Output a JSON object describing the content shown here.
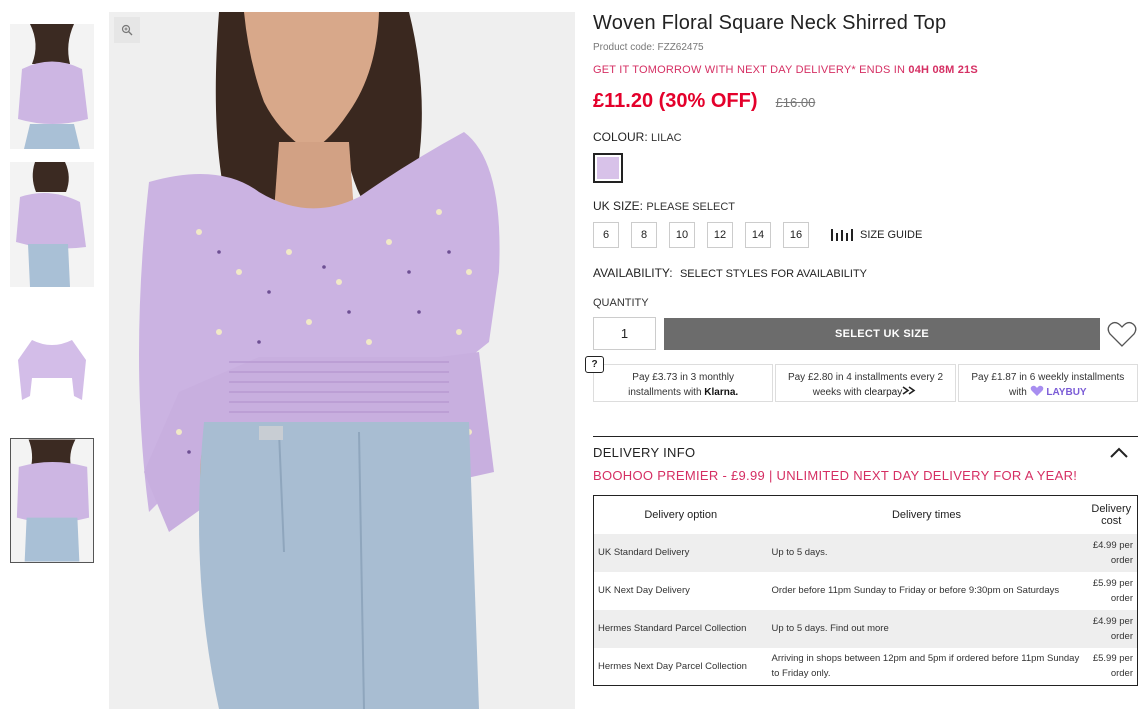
{
  "product": {
    "title": "Woven Floral Square Neck Shirred Top",
    "code": "Product code: FZZ62475",
    "delivery_promo_text": "GET IT TOMORROW WITH NEXT DAY DELIVERY* ENDS IN ",
    "delivery_promo_timer": "04H 08M 21S",
    "price_now": "£11.20 (30% OFF)",
    "price_was": "£16.00"
  },
  "colour": {
    "label": "COLOUR:",
    "value": "LILAC",
    "swatch_color": "#d8c2e9"
  },
  "size": {
    "label": "UK SIZE:",
    "value": "PLEASE SELECT",
    "options": [
      "6",
      "8",
      "10",
      "12",
      "14",
      "16"
    ],
    "guide_label": "SIZE GUIDE"
  },
  "availability": {
    "label": "AVAILABILITY:",
    "value": "SELECT STYLES FOR AVAILABILITY"
  },
  "quantity": {
    "label": "QUANTITY",
    "value": "1"
  },
  "actions": {
    "select_button": "SELECT UK SIZE"
  },
  "payments": {
    "help": "?",
    "klarna": {
      "line1": "Pay £3.73 in 3 monthly",
      "line2": "installments with",
      "brand": "Klarna."
    },
    "clearpay": {
      "line1": "Pay £2.80 in 4 installments every 2",
      "line2": "weeks with",
      "brand": "clearpay"
    },
    "laybuy": {
      "line1": "Pay £1.87 in 6 weekly installments",
      "line2": "with",
      "brand": "LAYBUY"
    }
  },
  "delivery": {
    "title": "DELIVERY INFO",
    "premier": "BOOHOO PREMIER - £9.99 | UNLIMITED NEXT DAY DELIVERY FOR A YEAR!",
    "headers": [
      "Delivery option",
      "Delivery times",
      "Delivery cost"
    ],
    "rows": [
      [
        "UK Standard Delivery",
        "Up to 5 days.",
        "£4.99 per order"
      ],
      [
        "UK Next Day Delivery",
        "Order before 11pm Sunday to Friday or before 9:30pm on Saturdays",
        "£5.99 per order"
      ],
      [
        "Hermes Standard Parcel Collection",
        "Up to 5 days. Find out more",
        "£4.99 per order"
      ],
      [
        "Hermes Next Day Parcel Collection",
        "Arriving in shops between 12pm and 5pm if ordered before 11pm Sunday to Friday only.",
        "£5.99 per order"
      ]
    ]
  },
  "colors": {
    "accent_pink": "#d52f63",
    "price_red": "#e4002b",
    "button_grey": "#6c6c6c"
  },
  "icons": [
    "zoom-icon",
    "size-guide-icon",
    "heart-icon",
    "chevron-up-icon",
    "laybuy-heart-icon"
  ]
}
